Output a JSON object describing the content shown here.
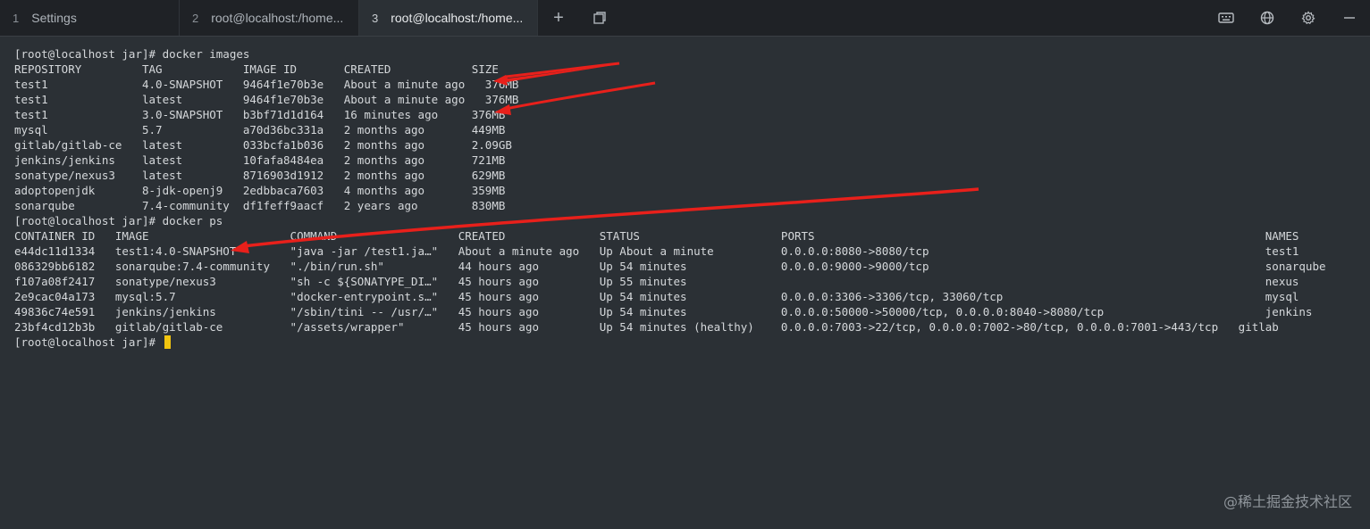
{
  "tabs": [
    {
      "num": "1",
      "label": "Settings"
    },
    {
      "num": "2",
      "label": "root@localhost:/home..."
    },
    {
      "num": "3",
      "label": "root@localhost:/home..."
    }
  ],
  "terminal": {
    "lines": [
      "[root@localhost jar]# docker images",
      "REPOSITORY         TAG            IMAGE ID       CREATED            SIZE",
      "test1              4.0-SNAPSHOT   9464f1e70b3e   About a minute ago   376MB",
      "test1              latest         9464f1e70b3e   About a minute ago   376MB",
      "test1              3.0-SNAPSHOT   b3bf71d1d164   16 minutes ago     376MB",
      "mysql              5.7            a70d36bc331a   2 months ago       449MB",
      "gitlab/gitlab-ce   latest         033bcfa1b036   2 months ago       2.09GB",
      "jenkins/jenkins    latest         10fafa8484ea   2 months ago       721MB",
      "sonatype/nexus3    latest         8716903d1912   2 months ago       629MB",
      "adoptopenjdk       8-jdk-openj9   2edbbaca7603   4 months ago       359MB",
      "sonarqube          7.4-community  df1feff9aacf   2 years ago        830MB",
      "[root@localhost jar]# docker ps",
      "CONTAINER ID   IMAGE                     COMMAND                  CREATED              STATUS                     PORTS                                                                   NAMES",
      "e44dc11d1334   test1:4.0-SNAPSHOT        \"java -jar /test1.ja…\"   About a minute ago   Up About a minute          0.0.0.0:8080->8080/tcp                                                  test1",
      "086329bb6182   sonarqube:7.4-community   \"./bin/run.sh\"           44 hours ago         Up 54 minutes              0.0.0.0:9000->9000/tcp                                                  sonarqube",
      "f107a08f2417   sonatype/nexus3           \"sh -c ${SONATYPE_DI…\"   45 hours ago         Up 55 minutes                                                                                      nexus",
      "2e9cac04a173   mysql:5.7                 \"docker-entrypoint.s…\"   45 hours ago         Up 54 minutes              0.0.0.0:3306->3306/tcp, 33060/tcp                                       mysql",
      "49836c74e591   jenkins/jenkins           \"/sbin/tini -- /usr/…\"   45 hours ago         Up 54 minutes              0.0.0.0:50000->50000/tcp, 0.0.0.0:8040->8080/tcp                        jenkins",
      "23bf4cd12b3b   gitlab/gitlab-ce          \"/assets/wrapper\"        45 hours ago         Up 54 minutes (healthy)    0.0.0.0:7003->22/tcp, 0.0.0.0:7002->80/tcp, 0.0.0.0:7001->443/tcp   gitlab"
    ],
    "prompt": "[root@localhost jar]# "
  },
  "watermark": "@稀土掘金技术社区",
  "colors": {
    "arrow": "#e8201b",
    "cursor": "#f1c40f",
    "background": "#2b3035",
    "tabbar": "#1f2226"
  },
  "icons": [
    "plus-icon",
    "copy-window-icon",
    "keyboard-icon",
    "globe-icon",
    "gear-icon",
    "minimize-icon"
  ]
}
